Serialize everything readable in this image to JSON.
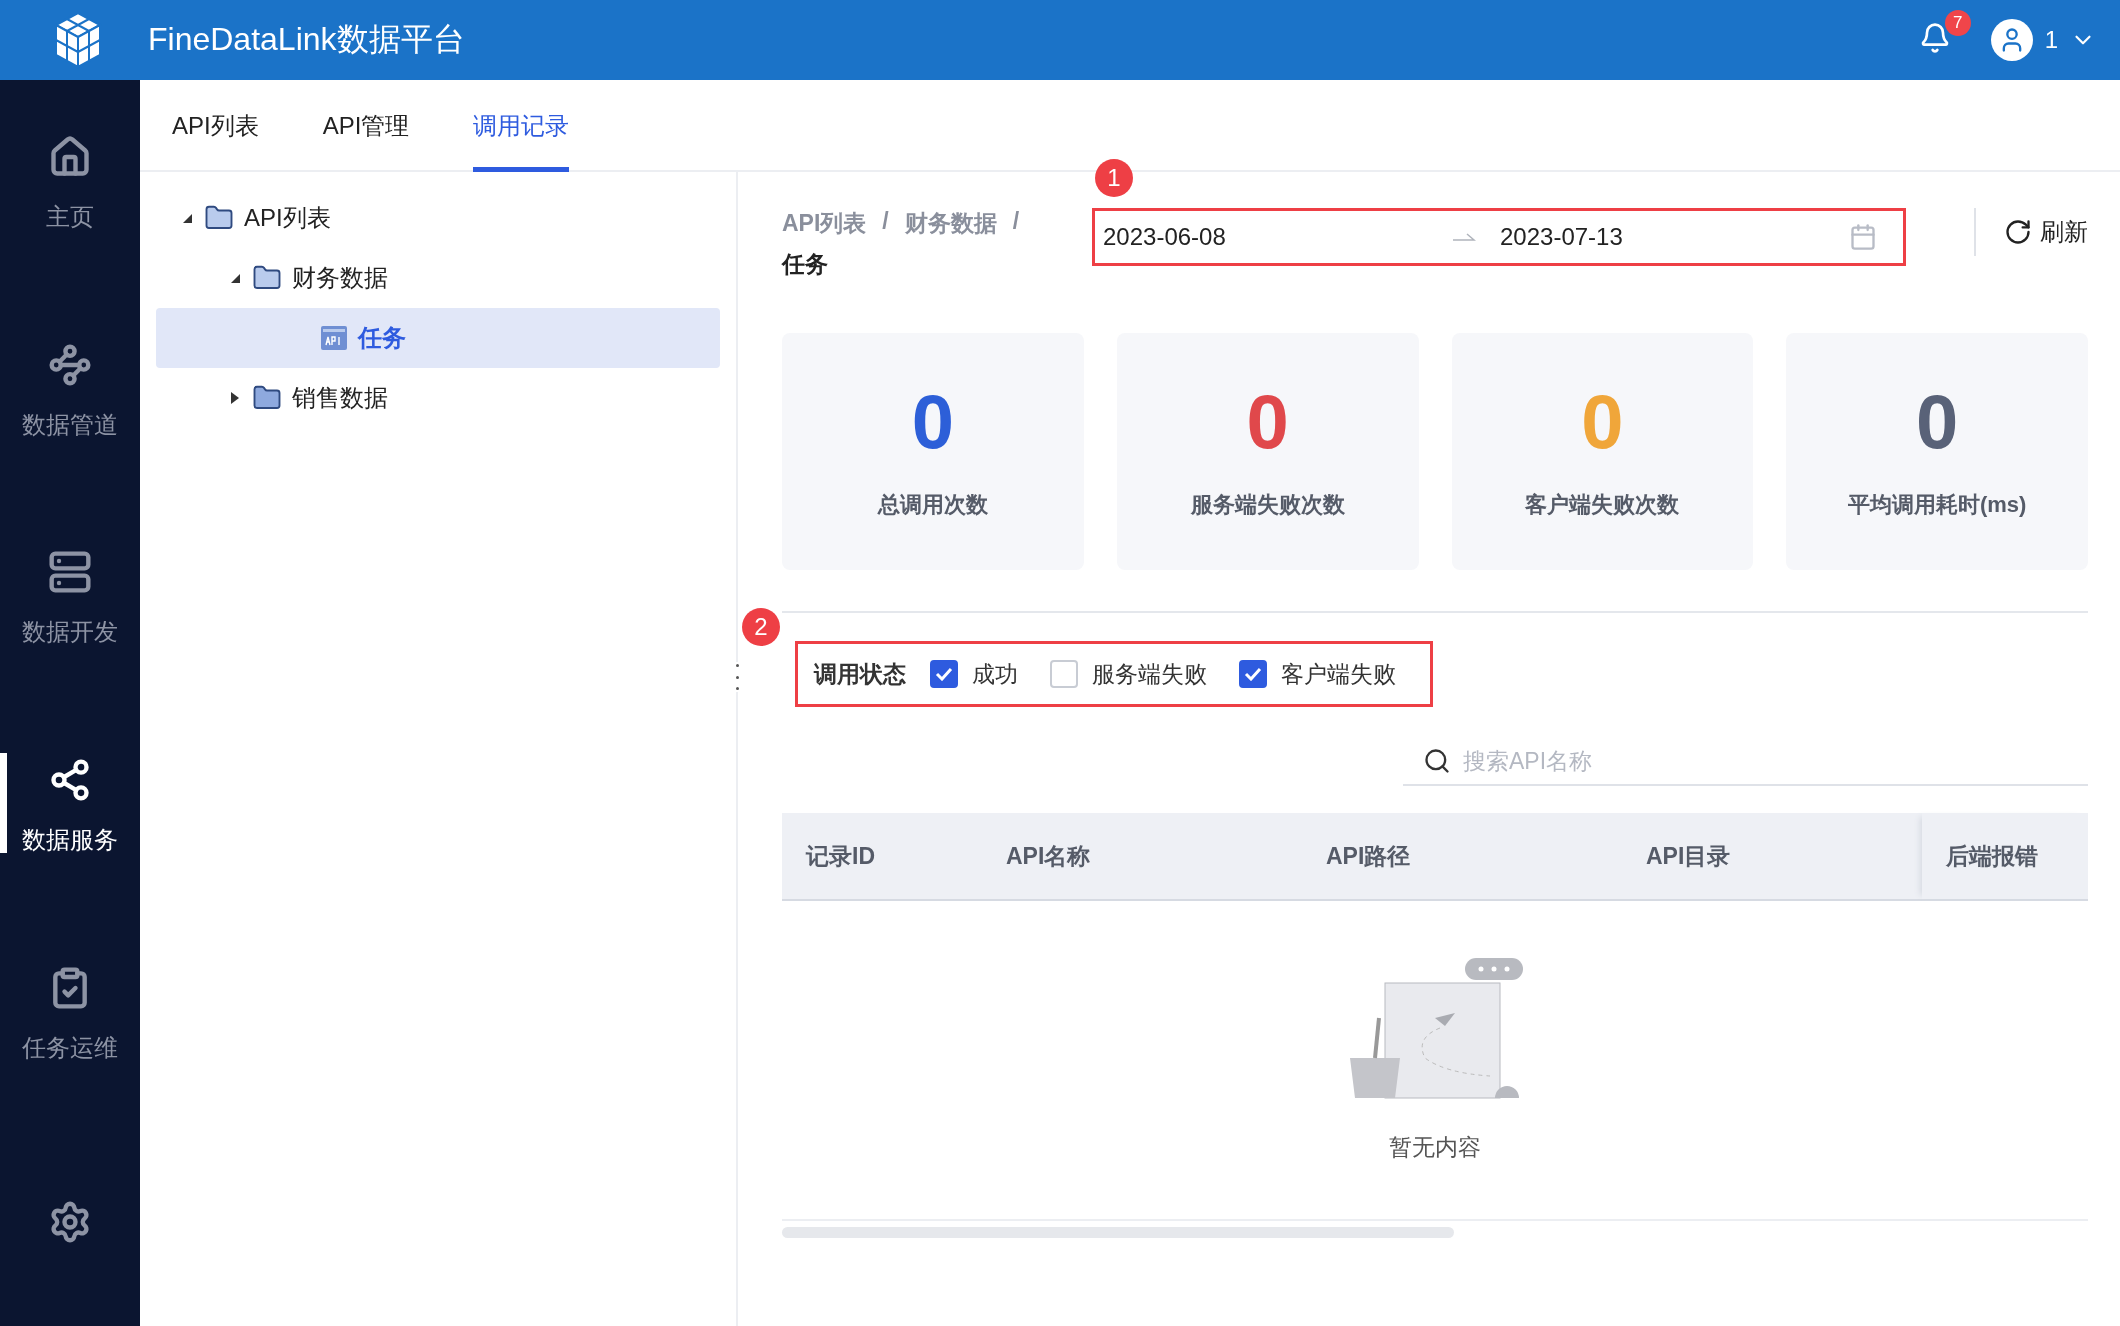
{
  "header": {
    "title": "FineDataLink数据平台",
    "notification_count": "7",
    "user": "1"
  },
  "nav": [
    {
      "label": "主页",
      "kind": "home",
      "selected": false
    },
    {
      "label": "数据管道",
      "kind": "pipeline",
      "selected": false
    },
    {
      "label": "数据开发",
      "kind": "develop",
      "selected": false
    },
    {
      "label": "数据服务",
      "kind": "service",
      "selected": true
    },
    {
      "label": "任务运维",
      "kind": "ops",
      "selected": false
    },
    {
      "kind": "settings",
      "selected": false
    }
  ],
  "tabs": [
    {
      "label": "API列表",
      "selected": false
    },
    {
      "label": "API管理",
      "selected": false
    },
    {
      "label": "调用记录",
      "selected": true
    }
  ],
  "tree": [
    {
      "label": "API列表",
      "kind": "folder",
      "expanded": true,
      "selected": false,
      "children": [
        {
          "label": "财务数据",
          "kind": "folder",
          "expanded": true,
          "selected": false,
          "children": [
            {
              "label": "任务",
              "kind": "api",
              "selected": true
            }
          ]
        },
        {
          "label": "销售数据",
          "kind": "folder",
          "expanded": false,
          "selected": false
        }
      ]
    }
  ],
  "breadcrumb": {
    "items": [
      "API列表",
      "财务数据",
      "任务"
    ],
    "separator": "/"
  },
  "date_range": {
    "start": "2023-06-08",
    "end": "2023-07-13",
    "annotation": "1"
  },
  "refresh": "刷新",
  "stats": [
    {
      "value": "0",
      "label": "总调用次数",
      "color": "#2d5fd8"
    },
    {
      "value": "0",
      "label": "服务端失败次数",
      "color": "#e0484b"
    },
    {
      "value": "0",
      "label": "客户端失败次数",
      "color": "#f0a63a"
    },
    {
      "value": "0",
      "label": "平均调用耗时(ms)",
      "color": "#596278"
    }
  ],
  "filter": {
    "label": "调用状态",
    "annotation": "2",
    "options": [
      {
        "label": "成功",
        "checked": true
      },
      {
        "label": "服务端失败",
        "checked": false
      },
      {
        "label": "客户端失败",
        "checked": true
      }
    ]
  },
  "search": {
    "placeholder": "搜索API名称"
  },
  "table": {
    "columns": [
      "记录ID",
      "API名称",
      "API路径",
      "API目录",
      "后端报错"
    ],
    "empty_text": "暂无内容"
  }
}
